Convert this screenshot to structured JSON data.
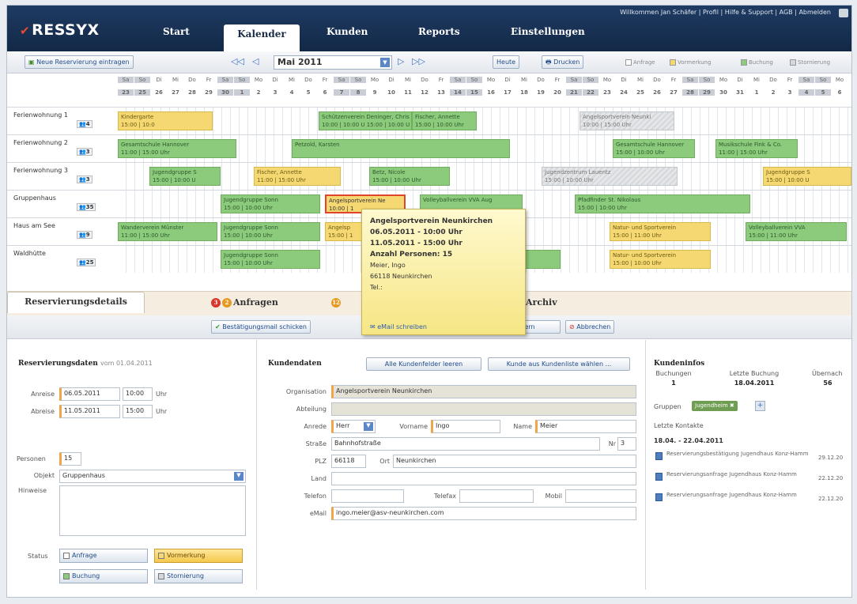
{
  "header": {
    "logo": "RESSYX",
    "nav": [
      "Start",
      "Kalender",
      "Kunden",
      "Reports",
      "Einstellungen"
    ],
    "top_links": "Willkommen Jan Schäfer | Profil | Hilfe & Support | AGB | Abmelden"
  },
  "toolbar": {
    "new_res": "Neue Reservierung eintragen",
    "month": "Mai 2011",
    "today": "Heute",
    "print": "Drucken",
    "legend": [
      "Anfrage",
      "Vormerkung",
      "Buchung",
      "Stornierung"
    ]
  },
  "calendar": {
    "weekdays": [
      "Sa",
      "So",
      "Di",
      "Mi",
      "Do",
      "Fr",
      "Sa",
      "So",
      "Mo",
      "Di",
      "Mi",
      "Do",
      "Fr",
      "Sa",
      "So",
      "Mo",
      "Di",
      "Mi",
      "Do",
      "Fr",
      "Sa",
      "So",
      "Mo",
      "Di",
      "Mi",
      "Do",
      "Fr",
      "Sa",
      "So",
      "Mo",
      "Di",
      "Mi",
      "Do",
      "Fr",
      "Sa",
      "So",
      "Mo",
      "Di",
      "Mi",
      "Do",
      "Fr",
      "Sa",
      "So",
      "Mo"
    ],
    "daynums": [
      "23",
      "25",
      "26",
      "27",
      "28",
      "29",
      "30",
      "1",
      "2",
      "3",
      "4",
      "5",
      "6",
      "7",
      "8",
      "9",
      "10",
      "11",
      "12",
      "13",
      "14",
      "15",
      "16",
      "17",
      "18",
      "19",
      "20",
      "21",
      "22",
      "23",
      "24",
      "25",
      "26",
      "27",
      "28",
      "29",
      "30",
      "31",
      "1",
      "2",
      "3",
      "4",
      "5",
      "6"
    ],
    "rows": [
      {
        "name": "Ferienwohnung 1",
        "count": "4",
        "res": [
          {
            "t": "Kindergarte",
            "s": "15:00 | 10:0",
            "type": "y"
          },
          {
            "t": "Schützenverein Deninger, Chris",
            "s": "10:00 | 10:00 U 15:00 | 10:00 U",
            "type": "g"
          },
          {
            "t": "Fischer, Annette",
            "s": "15:00 | 10:00 Uhr",
            "type": "g"
          },
          {
            "t": "Angelsportverein Neunki",
            "s": "10:00 | 15:00 Uhr",
            "type": "gr"
          }
        ]
      },
      {
        "name": "Ferienwohnung 2",
        "count": "3",
        "res": [
          {
            "t": "Gesamtschule Hannover",
            "s": "11:00 | 15:00 Uhr",
            "type": "g"
          },
          {
            "t": "Petzold, Karsten",
            "s": "",
            "type": "g"
          },
          {
            "t": "Gesamtschule Hannover",
            "s": "15:00 | 10:00 Uhr",
            "type": "g"
          },
          {
            "t": "Musikschule Fink & Co.",
            "s": "11:00 | 15:00 Uhr",
            "type": "g"
          }
        ]
      },
      {
        "name": "Ferienwohnung 3",
        "count": "3",
        "res": [
          {
            "t": "Jugendgruppe S",
            "s": "15:00 | 10:00 U",
            "type": "g"
          },
          {
            "t": "Fischer, Annette",
            "s": "11:00 | 15:00 Uhr",
            "type": "y"
          },
          {
            "t": "Betz, Nicole",
            "s": "15:00 | 10:00 Uhr",
            "type": "g"
          },
          {
            "t": "Jugendzentrum Lauentz",
            "s": "15:00 | 10:00 Uhr",
            "type": "gr"
          },
          {
            "t": "Jugendgruppe S",
            "s": "15:00 | 10:00 U",
            "type": "y"
          }
        ]
      },
      {
        "name": "Gruppenhaus",
        "count": "35",
        "res": [
          {
            "t": "Jugendgruppe Sonn",
            "s": "15:00 | 10:00 Uhr",
            "type": "g"
          },
          {
            "t": "Angelsportverein Ne",
            "s": "10:00 | 1",
            "type": "sel"
          },
          {
            "t": "Volleyballverein VVA Aug",
            "s": "",
            "type": "g"
          },
          {
            "t": "Pfadfinder St. Nikolaus",
            "s": "15:00 | 10:00 Uhr",
            "type": "g"
          }
        ]
      },
      {
        "name": "Haus am See",
        "count": "9",
        "res": [
          {
            "t": "Wanderverein Münster",
            "s": "11:00 | 15:00 Uhr",
            "type": "g"
          },
          {
            "t": "Jugendgruppe Sonn",
            "s": "15:00 | 10:00 Uhr",
            "type": "g"
          },
          {
            "t": "Angelsp",
            "s": "15:00 | 1",
            "type": "y"
          },
          {
            "t": "Natur- und Sportverein",
            "s": "15:00 | 11:00 Uhr",
            "type": "y"
          },
          {
            "t": "Volleyballverein VVA",
            "s": "15:00 | 11:00 Uhr",
            "type": "g"
          }
        ]
      },
      {
        "name": "Waldhütte",
        "count": "25",
        "res": [
          {
            "t": "Jugendgruppe Sonn",
            "s": "15:00 | 10:00 Uhr",
            "type": "g"
          },
          {
            "t": "",
            "s": "",
            "type": "g"
          },
          {
            "t": "Natur- und Sportverein",
            "s": "15:00 | 10:00 Uhr",
            "type": "y"
          }
        ]
      }
    ]
  },
  "tooltip": {
    "title": "Angelsportverein Neunkirchen",
    "from": "06.05.2011 - 10:00 Uhr",
    "to": "11.05.2011 - 15:00 Uhr",
    "persons": "Anzahl Personen: 15",
    "name": "Meier, Ingo",
    "city": "66118 Neunkirchen",
    "tel": "Tel.:",
    "mail": "eMail schreiben"
  },
  "tabs": {
    "details": "Reservierungsdetails",
    "requests": "Anfragen",
    "req_badges": [
      "3",
      "2"
    ],
    "second_badge": "12",
    "archive": "Archiv"
  },
  "actions": {
    "confirm": "Bestätigungsmail schicken",
    "save": "chern",
    "cancel": "Abbrechen"
  },
  "res": {
    "title": "Reservierungsdaten",
    "since": "vom 01.04.2011",
    "arr_lbl": "Anreise",
    "arr_date": "06.05.2011",
    "arr_time": "10:00",
    "dep_lbl": "Abreise",
    "dep_date": "11.05.2011",
    "dep_time": "15:00",
    "uhr": "Uhr",
    "persons_lbl": "Personen",
    "persons": "15",
    "object_lbl": "Objekt",
    "object": "Gruppenhaus",
    "notes_lbl": "Hinweise",
    "status_lbl": "Status",
    "status": [
      "Anfrage",
      "Vormerkung",
      "Buchung",
      "Stornierung"
    ]
  },
  "cust": {
    "title": "Kundendaten",
    "clear": "Alle Kundenfelder leeren",
    "choose": "Kunde aus Kundenliste wählen ...",
    "org_lbl": "Organisation",
    "org": "Angelsportverein Neunkirchen",
    "dept_lbl": "Abteilung",
    "salut_lbl": "Anrede",
    "salut": "Herr",
    "first_lbl": "Vorname",
    "first": "Ingo",
    "last_lbl": "Name",
    "last": "Meier",
    "street_lbl": "Straße",
    "street": "Bahnhofstraße",
    "nr_lbl": "Nr",
    "nr": "3",
    "zip_lbl": "PLZ",
    "zip": "66118",
    "city_lbl": "Ort",
    "city": "Neunkirchen",
    "country_lbl": "Land",
    "tel_lbl": "Telefon",
    "fax_lbl": "Telefax",
    "mobile_lbl": "Mobil",
    "mail_lbl": "eMail",
    "mail": "ingo.meier@asv-neunkirchen.com"
  },
  "info": {
    "title": "Kundeninfos",
    "bookings_lbl": "Buchungen",
    "bookings": "1",
    "last_lbl": "Letzte Buchung",
    "last": "18.04.2011",
    "stay_lbl": "Übernach",
    "stay": "56",
    "groups_lbl": "Gruppen",
    "group": "Jugendheim",
    "contacts_lbl": "Letzte Kontakte",
    "range": "18.04. - 22.04.2011",
    "contacts": [
      {
        "t": "Reservierungsbestätigung Jugendhaus Konz-Hamm",
        "d": "29.12.20"
      },
      {
        "t": "Reservierungsanfrage Jugendhaus Konz-Hamm",
        "d": "22.12.20"
      },
      {
        "t": "Reservierungsanfrage Jugendhaus Konz-Hamm",
        "d": "22.12.20"
      }
    ]
  },
  "colors": {
    "header": "#1f3b63",
    "green": "#8cca7c",
    "yellow": "#f5d871",
    "accent": "#e0452c"
  }
}
